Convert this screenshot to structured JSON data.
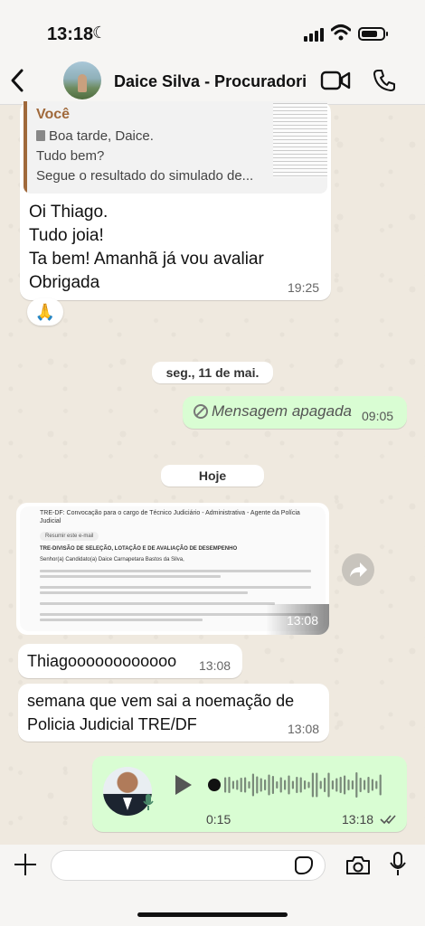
{
  "status_bar": {
    "time": "13:18"
  },
  "header": {
    "contact_name": "Daice Silva - Procuradori..."
  },
  "messages": {
    "quoted": {
      "author": "Você",
      "line1": "Boa tarde, Daice.",
      "line2": "Tudo bem?",
      "line3": "Segue o resultado do simulado de..."
    },
    "reply_text": "Oi Thiago.\nTudo joia!\nTa bem! Amanhã já vou avaliar\nObrigada",
    "reply_time": "19:25",
    "reaction": "🙏",
    "date_chip_1": "seg., 11 de mai.",
    "deleted_text": "Mensagem apagada",
    "deleted_time": "09:05",
    "date_chip_2": "Hoje",
    "image_time": "13:08",
    "image_content": {
      "subject": "TRE-DF: Convocação para o cargo de Técnico Judiciário - Administrativa - Agente da Polícia",
      "subject2": "Judicial",
      "summary": "Resumir este e-mail",
      "sender": "TRE-DIVISÃO DE SELEÇÃO, LOTAÇÃO E DE AVALIAÇÃO DE DESEMPENHO",
      "greeting": "Senhor(a) Candidato(a) Daice Carnapetara Bastos da Silva,"
    },
    "msg2_text": "Thiagoooooooooooo",
    "msg2_time": "13:08",
    "msg3_text": "semana que vem sai a noemação de\nPolicia Judicial TRE/DF",
    "msg3_time": "13:08",
    "voice": {
      "duration": "0:15",
      "time": "13:18"
    }
  },
  "colors": {
    "incoming": "#ffffff",
    "outgoing": "#d9fdd3",
    "quote_accent": "#a0693b"
  }
}
